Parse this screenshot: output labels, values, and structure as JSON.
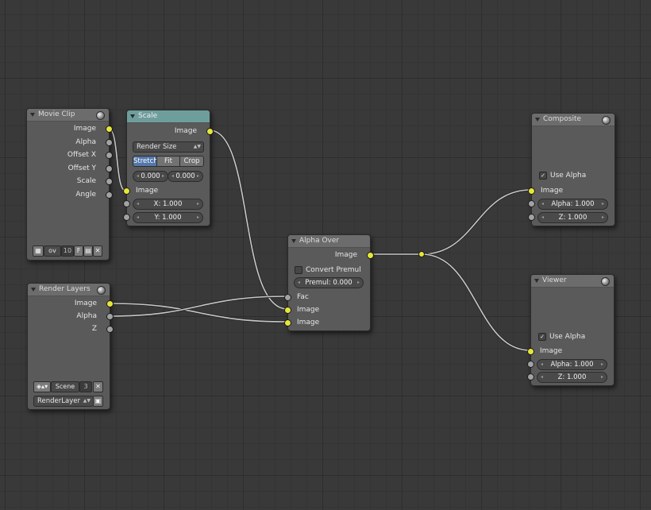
{
  "nodes": {
    "movie_clip": {
      "title": "Movie Clip",
      "outputs": [
        "Image",
        "Alpha",
        "Offset X",
        "Offset Y",
        "Scale",
        "Angle"
      ],
      "clip_name": "ov",
      "users_count": "10",
      "fake_user": "F"
    },
    "scale": {
      "title": "Scale",
      "output": "Image",
      "space_dropdown": "Render Size",
      "mode_buttons": [
        "Stretch",
        "Fit",
        "Crop"
      ],
      "active_mode": "Stretch",
      "offset_x": "0.000",
      "offset_y": "0.000",
      "input_image": "Image",
      "x_field": "X: 1.000",
      "y_field": "Y: 1.000"
    },
    "render_layers": {
      "title": "Render Layers",
      "outputs": [
        "Image",
        "Alpha",
        "Z"
      ],
      "scene_name": "Scene",
      "scene_users": "3",
      "layer_name": "RenderLayer"
    },
    "alpha_over": {
      "title": "Alpha Over",
      "output": "Image",
      "convert_premul_label": "Convert Premul",
      "convert_premul_checked": false,
      "premul_field": "Premul: 0.000",
      "inputs": [
        "Fac",
        "Image",
        "Image"
      ]
    },
    "composite": {
      "title": "Composite",
      "use_alpha_label": "Use Alpha",
      "use_alpha_checked": true,
      "input_image": "Image",
      "alpha_field": "Alpha: 1.000",
      "z_field": "Z: 1.000"
    },
    "viewer": {
      "title": "Viewer",
      "use_alpha_label": "Use Alpha",
      "use_alpha_checked": true,
      "input_image": "Image",
      "alpha_field": "Alpha: 1.000",
      "z_field": "Z: 1.000"
    }
  },
  "colors": {
    "socket_color": "#e6e63a",
    "socket_value": "#a2a2a2",
    "active_button": "#5577aa",
    "scale_header": "#6e9e9c",
    "link": "#c8c8c8"
  },
  "icons": {
    "check_glyph": "✓",
    "dropdown_glyph": "▲▼",
    "close_glyph": "✕",
    "left_arrow": "◂",
    "right_arrow": "▸"
  }
}
